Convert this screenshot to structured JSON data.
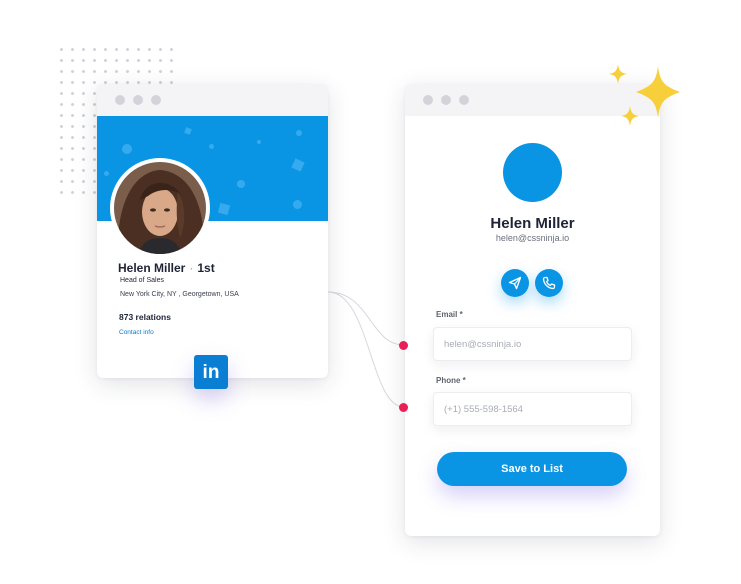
{
  "left_profile": {
    "name": "Helen Miller",
    "separator": "·",
    "degree": "1st",
    "title": "Head of Sales",
    "location": "New York City, NY , Georgetown, USA",
    "relations": "873 relations",
    "contact_link": "Contact info"
  },
  "linkedin_badge": {
    "label": "in",
    "icon": "linkedin-icon"
  },
  "right_card": {
    "name": "Helen Miller",
    "email": "helen@cssninja.io",
    "actions": [
      {
        "icon": "send-icon"
      },
      {
        "icon": "phone-icon"
      }
    ],
    "email_field": {
      "label": "Email *",
      "placeholder": "helen@cssninja.io",
      "value": ""
    },
    "phone_field": {
      "label": "Phone *",
      "placeholder": "(+1) 555-598-1564",
      "value": ""
    },
    "save_button": "Save to List"
  },
  "colors": {
    "brand_blue": "#0a95e4",
    "linkedin_blue": "#0a7ed2",
    "pin_red": "#ea1f55",
    "sparkle_gold": "#f7cf3a"
  }
}
